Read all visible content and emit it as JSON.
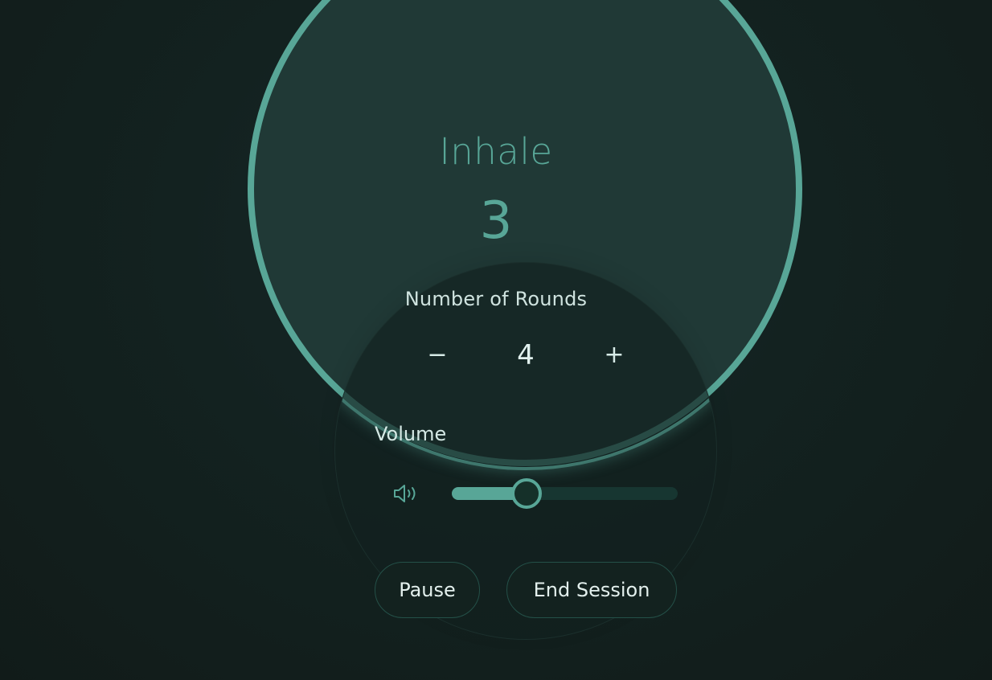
{
  "breathing": {
    "phase": "Inhale",
    "count": "3"
  },
  "rounds": {
    "label": "Number of Rounds",
    "decrement": "−",
    "value": "4",
    "increment": "+"
  },
  "volume": {
    "label": "Volume",
    "level_fraction": 0.33,
    "icon": "volume-icon"
  },
  "actions": {
    "pause": "Pause",
    "end_session": "End Session"
  },
  "colors": {
    "accent": "#58a697",
    "background": "#121d1b",
    "circle_fill": "#203936"
  }
}
